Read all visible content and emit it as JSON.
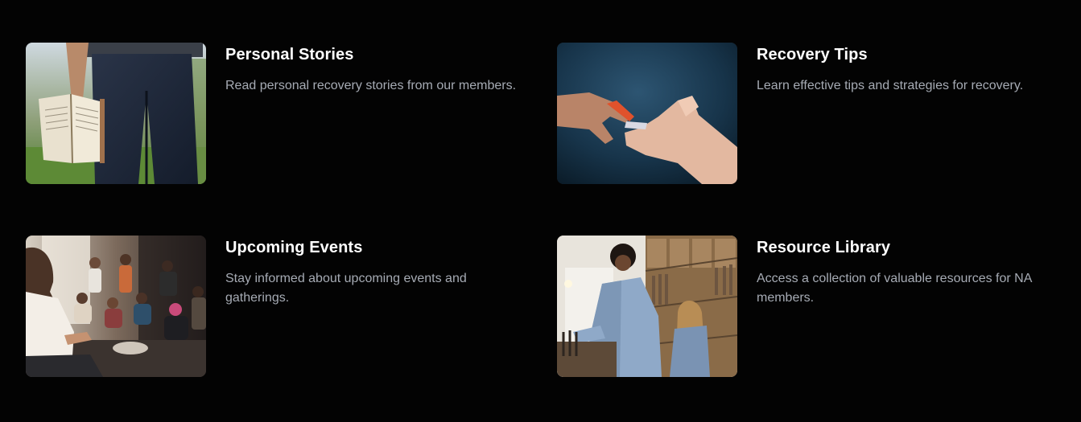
{
  "cards": [
    {
      "title": "Personal Stories",
      "description": "Read personal recovery stories from our members.",
      "image": "person-holding-open-book-photo"
    },
    {
      "title": "Recovery Tips",
      "description": "Learn effective tips and strategies for recovery.",
      "image": "hands-passing-item-photo"
    },
    {
      "title": "Upcoming Events",
      "description": "Stay informed about upcoming events and gatherings.",
      "image": "group-gathering-photo"
    },
    {
      "title": "Resource Library",
      "description": "Access a collection of valuable resources for NA members.",
      "image": "record-store-browsing-photo"
    }
  ]
}
